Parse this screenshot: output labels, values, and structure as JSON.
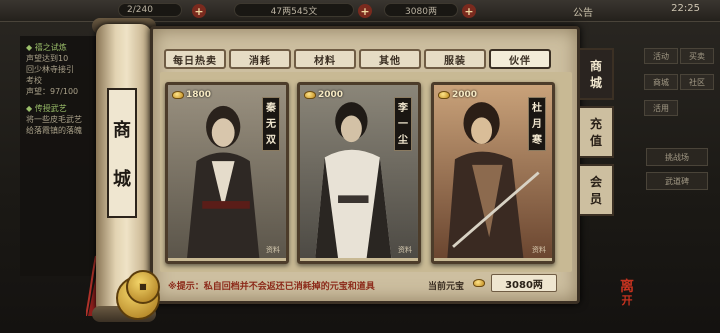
{
  "topbar": {
    "stamina": "2/240",
    "silver": "47两545文",
    "gold": "3080两",
    "notice": "公告",
    "clock": "22:25"
  },
  "left_quests": [
    {
      "text": "◆ 禧之试炼",
      "head": true
    },
    {
      "text": "声望达到10",
      "head": false
    },
    {
      "text": "回少林寺接引",
      "head": false
    },
    {
      "text": "考校",
      "head": false
    },
    {
      "text": "声望：97/100",
      "head": false
    },
    {
      "text": "◆ 传授武艺",
      "head": true
    },
    {
      "text": "将一些皮毛武艺",
      "head": false
    },
    {
      "text": "给落霞镇的落魄",
      "head": false
    }
  ],
  "right_buttons": [
    "活动",
    "买卖",
    "商城",
    "社区",
    "活用",
    "",
    "挑战场",
    "武道碑"
  ],
  "shop": {
    "title_chars": [
      "商",
      "城"
    ],
    "tabs": [
      "每日热卖",
      "消耗",
      "材料",
      "其他",
      "服装",
      "伙伴"
    ],
    "active_tab": 5,
    "side_tabs": [
      {
        "chars": [
          "商",
          "城"
        ],
        "active": true
      },
      {
        "chars": [
          "充",
          "值"
        ],
        "active": false
      },
      {
        "chars": [
          "会",
          "员"
        ],
        "active": false
      }
    ],
    "cards": [
      {
        "price": "1800",
        "name": [
          "秦",
          "无",
          "双"
        ],
        "stamp": "资料",
        "accent": "#7e7566"
      },
      {
        "price": "2000",
        "name": [
          "李",
          "一",
          "尘"
        ],
        "stamp": "资料",
        "accent": "#6e6a61"
      },
      {
        "price": "2000",
        "name": [
          "杜",
          "月",
          "寒"
        ],
        "stamp": "资料",
        "accent": "#8a5a3a"
      }
    ],
    "tip": "※提示：私自回档并不会返还已消耗掉的元宝和道具",
    "balance_label": "当前元宝",
    "balance_value": "3080两"
  },
  "leave_label": [
    "离",
    "开"
  ],
  "colors": {
    "panel": "#cdbfa0",
    "frame": "#3b3024",
    "tip_red": "#8c2a1a",
    "gold": "#f4d66a"
  }
}
